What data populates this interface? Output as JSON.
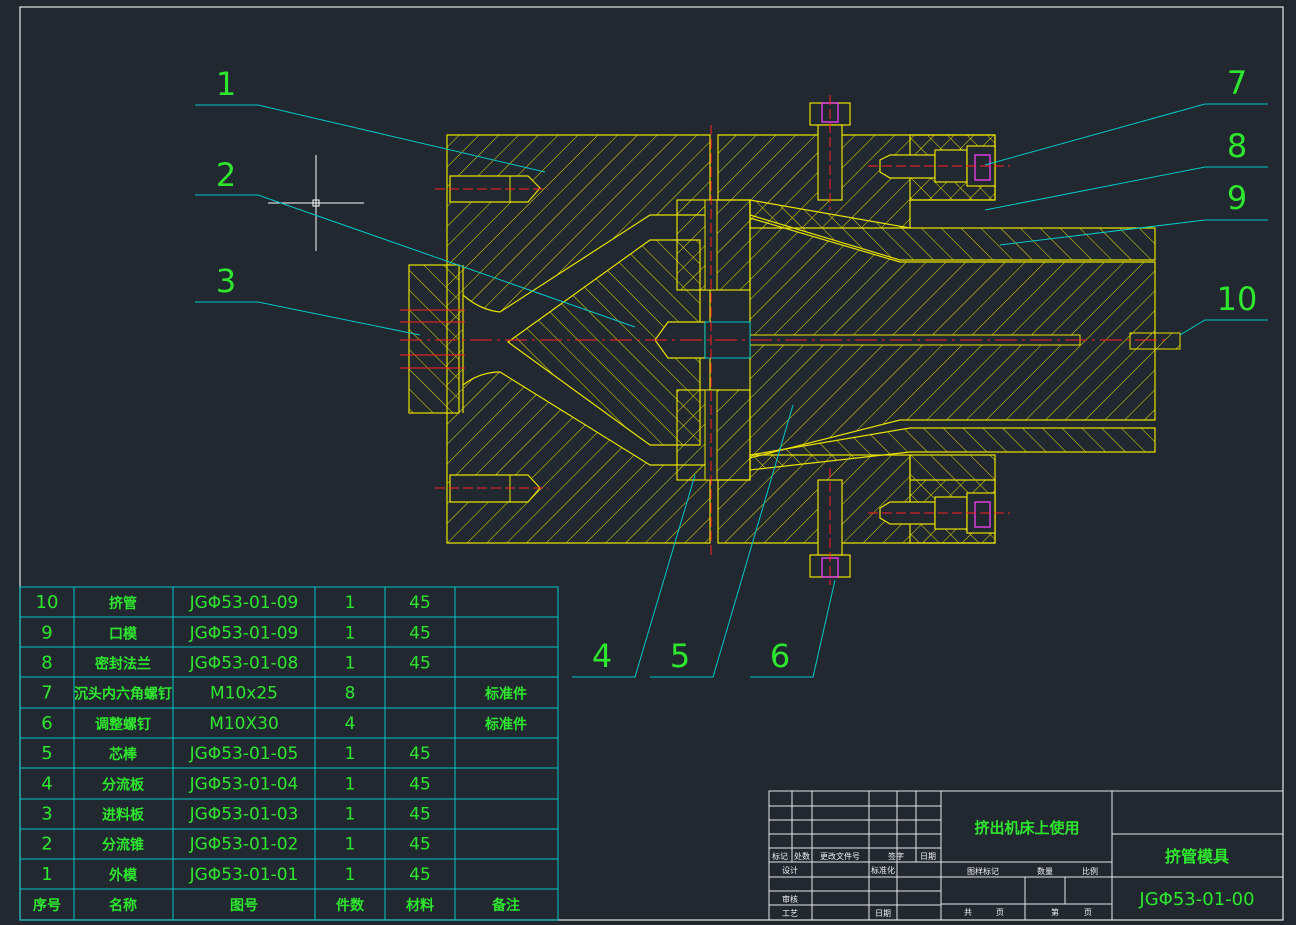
{
  "callouts": [
    "1",
    "2",
    "3",
    "4",
    "5",
    "6",
    "7",
    "8",
    "9",
    "10"
  ],
  "bom": {
    "header": {
      "no": "序号",
      "name": "名称",
      "drawing": "图号",
      "qty": "件数",
      "material": "材料",
      "note": "备注"
    },
    "rows": [
      {
        "no": "10",
        "name": "挤管",
        "drawing": "JGΦ53-01-09",
        "qty": "1",
        "material": "45",
        "note": ""
      },
      {
        "no": "9",
        "name": "口模",
        "drawing": "JGΦ53-01-09",
        "qty": "1",
        "material": "45",
        "note": ""
      },
      {
        "no": "8",
        "name": "密封法兰",
        "drawing": "JGΦ53-01-08",
        "qty": "1",
        "material": "45",
        "note": ""
      },
      {
        "no": "7",
        "name": "沉头内六角螺钉",
        "drawing": "M10x25",
        "qty": "8",
        "material": "",
        "note": "标准件"
      },
      {
        "no": "6",
        "name": "调整螺钉",
        "drawing": "M10X30",
        "qty": "4",
        "material": "",
        "note": "标准件"
      },
      {
        "no": "5",
        "name": "芯棒",
        "drawing": "JGΦ53-01-05",
        "qty": "1",
        "material": "45",
        "note": ""
      },
      {
        "no": "4",
        "name": "分流板",
        "drawing": "JGΦ53-01-04",
        "qty": "1",
        "material": "45",
        "note": ""
      },
      {
        "no": "3",
        "name": "进料板",
        "drawing": "JGΦ53-01-03",
        "qty": "1",
        "material": "45",
        "note": ""
      },
      {
        "no": "2",
        "name": "分流锥",
        "drawing": "JGΦ53-01-02",
        "qty": "1",
        "material": "45",
        "note": ""
      },
      {
        "no": "1",
        "name": "外模",
        "drawing": "JGΦ53-01-01",
        "qty": "1",
        "material": "45",
        "note": ""
      }
    ]
  },
  "title_block": {
    "usage": "挤出机床上使用",
    "part_name": "挤管模具",
    "drawing_no": "JGΦ53-01-00",
    "rev_labels": [
      "标记",
      "处数",
      "更改文件号",
      "签字",
      "日期"
    ],
    "sign_labels": {
      "design": "设计",
      "standard": "标准化",
      "review": "审核",
      "process": "工艺",
      "date": "日期"
    },
    "stage_labels": {
      "stage": "图样标记",
      "weight": "数量",
      "scale": "比例",
      "total": "共",
      "sheets": "页",
      "sheet": "第",
      "page": "页"
    }
  },
  "colors": {
    "background": "#212830",
    "frame": "#e6e6e6",
    "hatch": "#e8e000",
    "leader": "#00c8c8",
    "text": "#2ee62e",
    "center": "#ff2020",
    "screw": "#ff40ff"
  }
}
